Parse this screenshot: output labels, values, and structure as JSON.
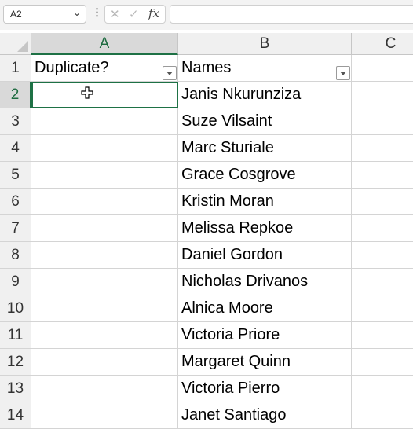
{
  "formula_bar": {
    "name_box": "A2",
    "cancel_glyph": "✕",
    "enter_glyph": "✓",
    "fx_glyph": "fx",
    "formula_value": ""
  },
  "columns": [
    {
      "label": "A"
    },
    {
      "label": "B"
    },
    {
      "label": "C"
    }
  ],
  "rows": [
    "1",
    "2",
    "3",
    "4",
    "5",
    "6",
    "7",
    "8",
    "9",
    "10",
    "11",
    "12",
    "13",
    "14"
  ],
  "header_cells": {
    "a1": "Duplicate?",
    "b1": "Names"
  },
  "names": [
    "Janis Nkurunziza",
    "Suze Vilsaint",
    "Marc Sturiale",
    "Grace Cosgrove",
    "Kristin Moran",
    "Melissa Repkoe",
    "Daniel Gordon",
    "Nicholas Drivanos",
    "Alnica Moore",
    "Victoria Priore",
    "Margaret Quinn",
    "Victoria Pierro",
    "Janet Santiago"
  ],
  "active_cell": "A2",
  "colors": {
    "selection": "#1e7145",
    "header_bg": "#f0f0f0",
    "gridline": "#d4d4d4"
  }
}
